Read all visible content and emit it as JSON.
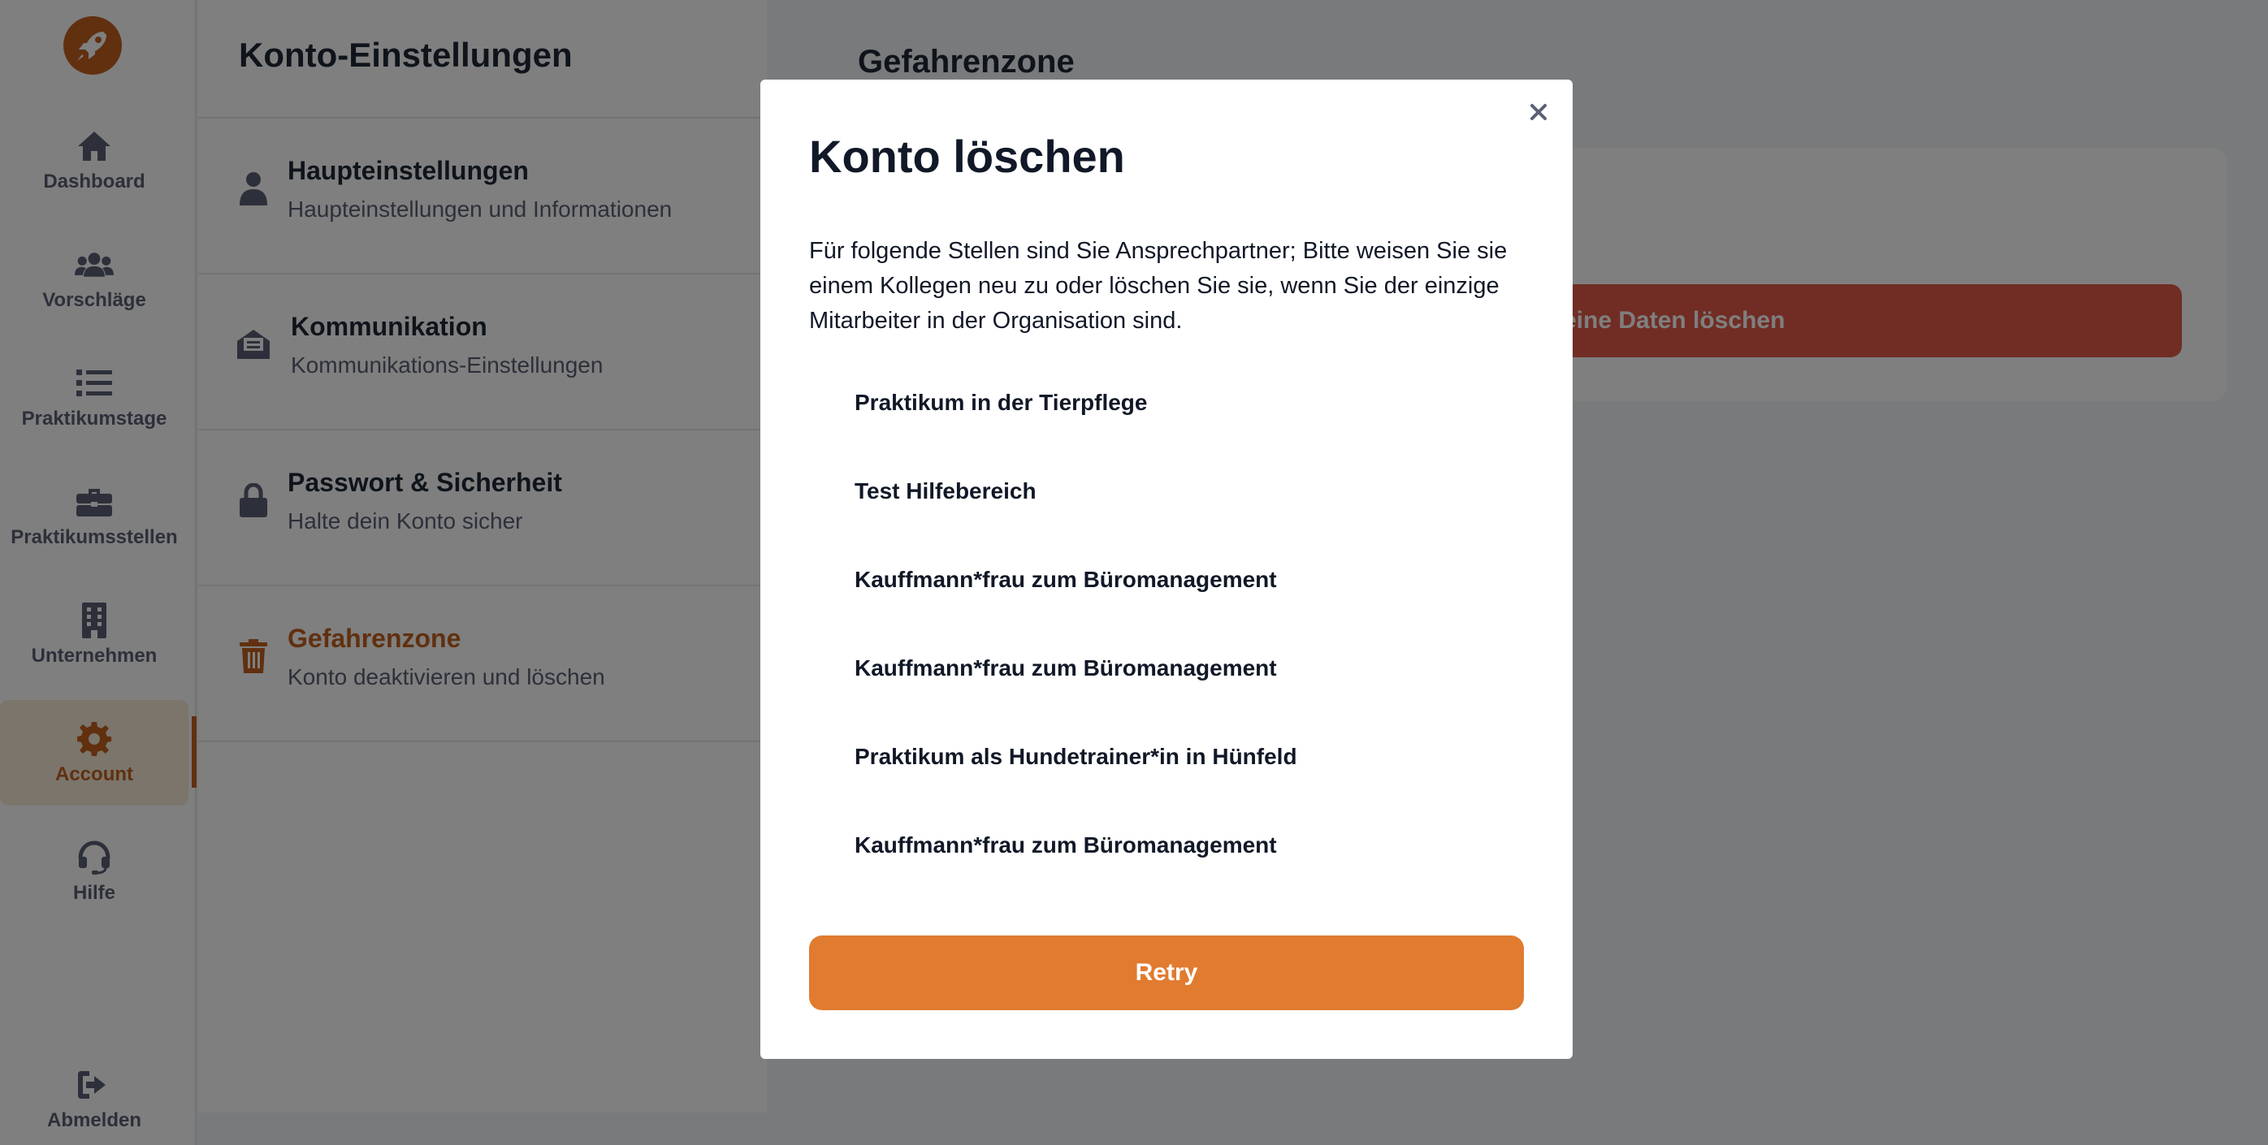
{
  "sidebar": {
    "items": [
      {
        "label": "Dashboard",
        "icon": "home-icon"
      },
      {
        "label": "Vorschläge",
        "icon": "users-icon"
      },
      {
        "label": "Praktikumstage",
        "icon": "list-icon"
      },
      {
        "label": "Praktikumsstellen",
        "icon": "briefcase-icon"
      },
      {
        "label": "Unternehmen",
        "icon": "building-icon"
      },
      {
        "label": "Account",
        "icon": "gear-icon"
      },
      {
        "label": "Hilfe",
        "icon": "headset-icon"
      }
    ],
    "logout_label": "Abmelden",
    "active_index": 5
  },
  "settings": {
    "title": "Konto-Einstellungen",
    "items": [
      {
        "title": "Haupteinstellungen",
        "subtitle": "Haupteinstellungen und Informationen",
        "icon": "user-icon"
      },
      {
        "title": "Kommunikation",
        "subtitle": "Kommunikations-Einstellungen",
        "icon": "envelope-icon"
      },
      {
        "title": "Passwort & Sicherheit",
        "subtitle": "Halte dein Konto sicher",
        "icon": "lock-icon"
      },
      {
        "title": "Gefahrenzone",
        "subtitle": "Konto deaktivieren und löschen",
        "icon": "trash-icon"
      }
    ]
  },
  "main": {
    "title": "Gefahrenzone",
    "delete_data_label": "eine Daten löschen"
  },
  "modal": {
    "title": "Konto löschen",
    "text": "Für folgende Stellen sind Sie Ansprechpartner; Bitte weisen Sie sie einem Kollegen neu zu oder löschen Sie sie, wenn Sie der einzige Mitarbeiter in der Organisation sind.",
    "positions": [
      "Praktikum in der Tierpflege",
      "Test Hilfebereich",
      "Kauffmann*frau zum Büromanagement",
      "Kauffmann*frau zum Büromanagement",
      "Praktikum als Hundetrainer*in in Hünfeld",
      "Kauffmann*frau zum Büromanagement"
    ],
    "retry_label": "Retry",
    "close_icon": "close-icon"
  },
  "colors": {
    "accent": "#c2611f",
    "retry": "#e07b30",
    "danger": "#e25a48"
  }
}
